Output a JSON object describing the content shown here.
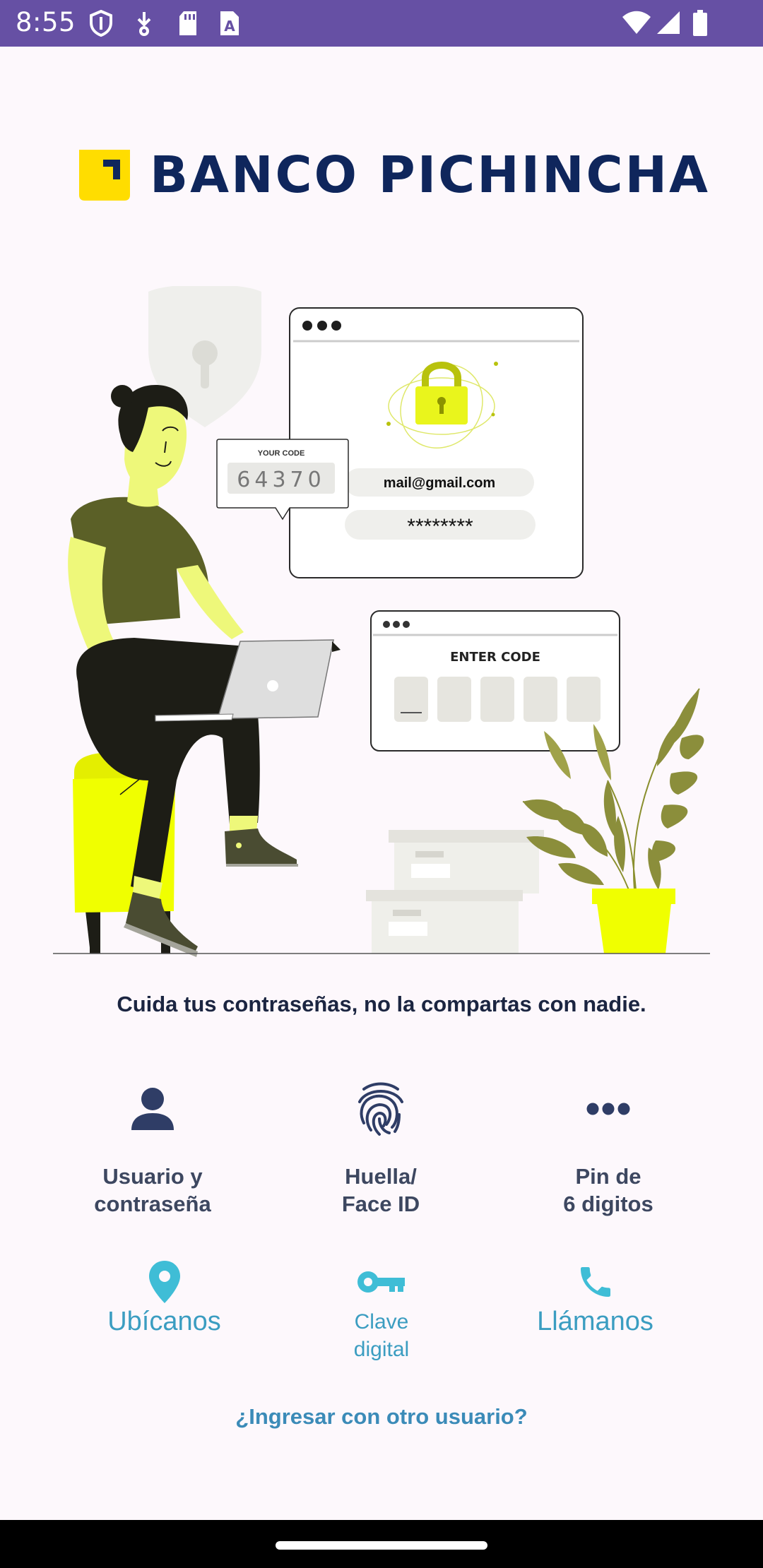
{
  "status_bar": {
    "time": "8:55",
    "icons": [
      "shield-icon",
      "download-icon",
      "sd-card-icon",
      "text-icon",
      "wifi-icon",
      "signal-icon",
      "battery-icon"
    ]
  },
  "brand": {
    "name": "BANCO PICHINCHA",
    "logo_color": "#ffdd00",
    "text_color": "#0f265c"
  },
  "illustration": {
    "code_bubble_title": "YOUR CODE",
    "code_value": "64370",
    "email": "mail@gmail.com",
    "password": "********",
    "enter_code_title": "ENTER CODE"
  },
  "tagline": "Cuida tus contraseñas, no la compartas con nadie.",
  "login_options": [
    {
      "icon": "person-icon",
      "line1": "Usuario y",
      "line2": "contraseña"
    },
    {
      "icon": "fingerprint-icon",
      "line1": "Huella/",
      "line2": "Face ID"
    },
    {
      "icon": "dots-icon",
      "line1": "Pin de",
      "line2": "6 digitos"
    }
  ],
  "quick_actions": [
    {
      "icon": "location-pin-icon",
      "label": "Ubícanos"
    },
    {
      "icon": "key-icon",
      "line1": "Clave",
      "line2": "digital"
    },
    {
      "icon": "phone-icon",
      "label": "Llámanos"
    }
  ],
  "other_user_link": "¿Ingresar con otro usuario?",
  "colors": {
    "status_bar": "#6650a4",
    "accent_link": "#3b8bb8",
    "quick_action": "#3b9dc1",
    "option_icon": "#2f3d66",
    "illustration_yellow": "#f0ff00"
  }
}
